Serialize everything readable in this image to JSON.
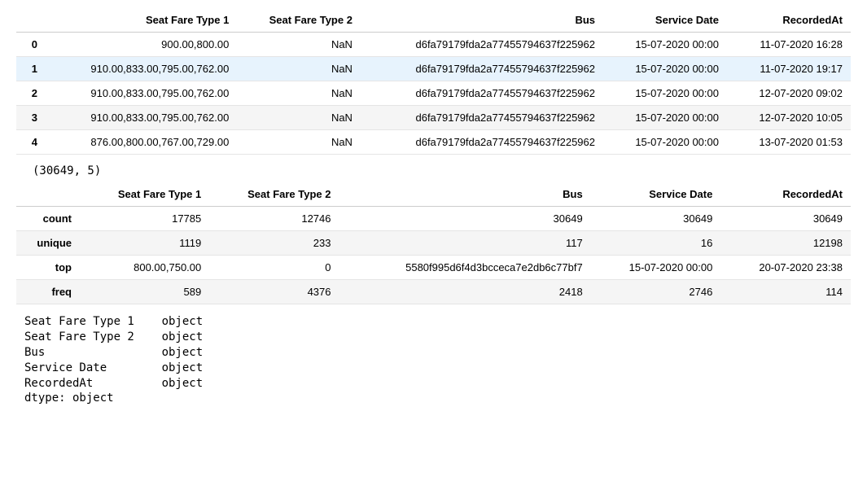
{
  "table1": {
    "columns": [
      "",
      "Seat Fare Type 1",
      "Seat Fare Type 2",
      "Bus",
      "Service Date",
      "RecordedAt"
    ],
    "rows": [
      {
        "idx": "0",
        "sf1": "900.00,800.00",
        "sf2": "NaN",
        "bus": "d6fa79179fda2a77455794637f225962",
        "sd": "15-07-2020 00:00",
        "ra": "11-07-2020 16:28",
        "hl": false
      },
      {
        "idx": "1",
        "sf1": "910.00,833.00,795.00,762.00",
        "sf2": "NaN",
        "bus": "d6fa79179fda2a77455794637f225962",
        "sd": "15-07-2020 00:00",
        "ra": "11-07-2020 19:17",
        "hl": true
      },
      {
        "idx": "2",
        "sf1": "910.00,833.00,795.00,762.00",
        "sf2": "NaN",
        "bus": "d6fa79179fda2a77455794637f225962",
        "sd": "15-07-2020 00:00",
        "ra": "12-07-2020 09:02",
        "hl": false
      },
      {
        "idx": "3",
        "sf1": "910.00,833.00,795.00,762.00",
        "sf2": "NaN",
        "bus": "d6fa79179fda2a77455794637f225962",
        "sd": "15-07-2020 00:00",
        "ra": "12-07-2020 10:05",
        "hl": false
      },
      {
        "idx": "4",
        "sf1": "876.00,800.00,767.00,729.00",
        "sf2": "NaN",
        "bus": "d6fa79179fda2a77455794637f225962",
        "sd": "15-07-2020 00:00",
        "ra": "13-07-2020 01:53",
        "hl": false
      }
    ]
  },
  "shape_text": "(30649, 5)",
  "table2": {
    "columns": [
      "",
      "Seat Fare Type 1",
      "Seat Fare Type 2",
      "Bus",
      "Service Date",
      "RecordedAt"
    ],
    "rows": [
      {
        "label": "count",
        "sf1": "17785",
        "sf2": "12746",
        "bus": "30649",
        "sd": "30649",
        "ra": "30649"
      },
      {
        "label": "unique",
        "sf1": "1119",
        "sf2": "233",
        "bus": "117",
        "sd": "16",
        "ra": "12198"
      },
      {
        "label": "top",
        "sf1": "800.00,750.00",
        "sf2": "0",
        "bus": "5580f995d6f4d3bcceca7e2db6c77bf7",
        "sd": "15-07-2020 00:00",
        "ra": "20-07-2020 23:38"
      },
      {
        "label": "freq",
        "sf1": "589",
        "sf2": "4376",
        "bus": "2418",
        "sd": "2746",
        "ra": "114"
      }
    ]
  },
  "dtypes": {
    "lines": [
      "Seat Fare Type 1    object",
      "Seat Fare Type 2    object",
      "Bus                 object",
      "Service Date        object",
      "RecordedAt          object",
      "dtype: object"
    ]
  }
}
